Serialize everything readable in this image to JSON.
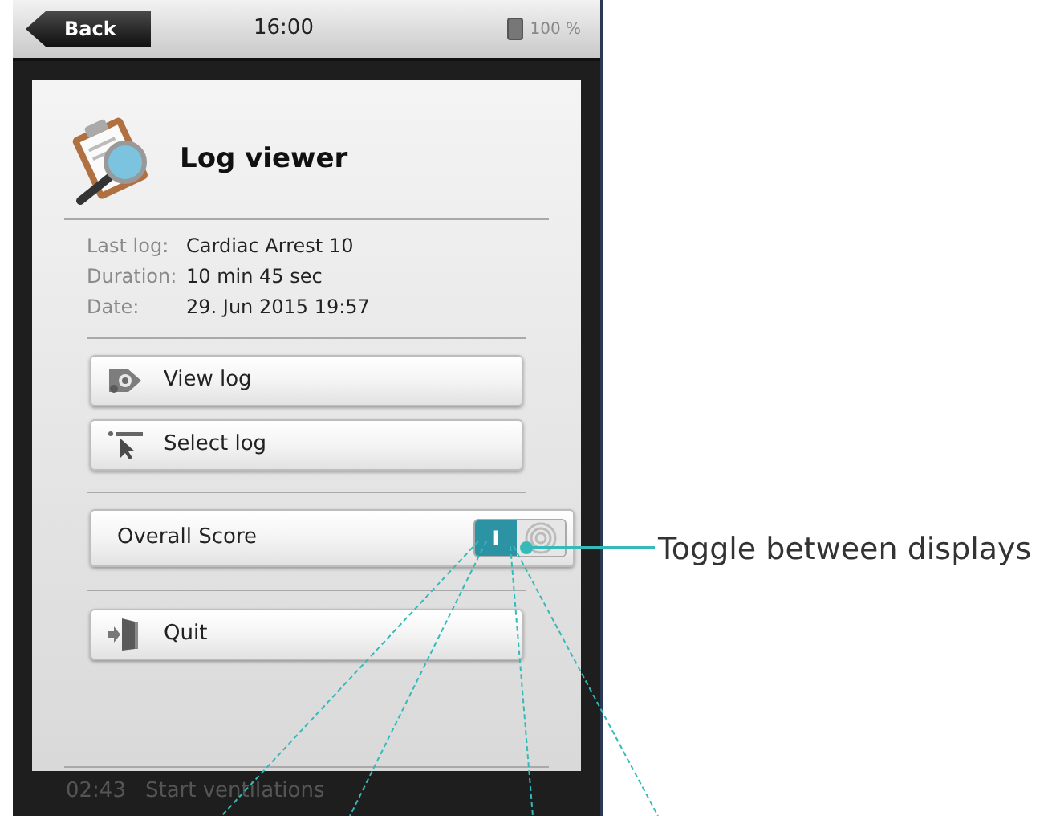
{
  "status_bar": {
    "back_button": "Back",
    "time": "16:00",
    "battery": "100 %"
  },
  "dialog": {
    "title": "Log viewer",
    "info": [
      {
        "label": "Last log:",
        "value": "Cardiac Arrest 10"
      },
      {
        "label": "Duration:",
        "value": "10 min 45 sec"
      },
      {
        "label": "Date:",
        "value": "29. Jun 2015 19:57"
      }
    ],
    "log_buttons": [
      {
        "kind": "view",
        "label": "View log"
      },
      {
        "kind": "select",
        "label": "Select log"
      }
    ],
    "score_row": {
      "label": "Overall Score",
      "toggle": {
        "on": true,
        "label": "I"
      }
    },
    "quit_button": "Quit"
  },
  "background_event": {
    "time": "02:43",
    "text": "Start ventilations"
  },
  "annotation": "Toggle between displays"
}
